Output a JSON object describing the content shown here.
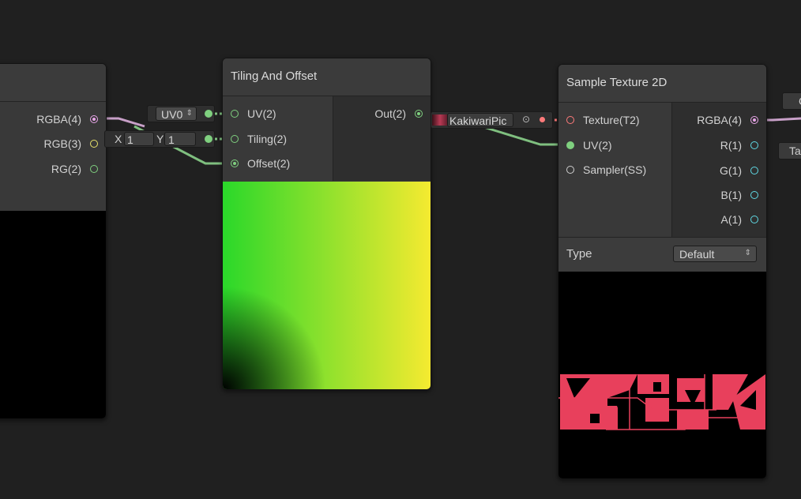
{
  "left_node": {
    "outputs": [
      {
        "label": "RGBA(4)",
        "color": "#e8a6e8"
      },
      {
        "label": "RGB(3)",
        "color": "#e9e36a"
      },
      {
        "label": "RG(2)",
        "color": "#7fd07f"
      }
    ]
  },
  "tiling_node": {
    "title": "Tiling And Offset",
    "inputs": [
      {
        "label": "UV(2)"
      },
      {
        "label": "Tiling(2)"
      },
      {
        "label": "Offset(2)"
      }
    ],
    "output": {
      "label": "Out(2)"
    },
    "uv_control": {
      "value": "UV0",
      "arrow": "⇕"
    },
    "tiling_control": {
      "x_label": "X",
      "x_value": "1",
      "y_label": "Y",
      "y_value": "1"
    }
  },
  "texture_property": {
    "name": "KakiwariPic",
    "icon": "gear-icon"
  },
  "sample_node": {
    "title": "Sample Texture 2D",
    "inputs": [
      {
        "label": "Texture(T2)",
        "color": "#ff7a7a"
      },
      {
        "label": "UV(2)",
        "color": "#7fd07f"
      },
      {
        "label": "Sampler(SS)",
        "color": "#cfcfcf"
      }
    ],
    "outputs": [
      {
        "label": "RGBA(4)",
        "color": "#e8a6e8"
      },
      {
        "label": "R(1)",
        "color": "#5fd9e4"
      },
      {
        "label": "G(1)",
        "color": "#5fd9e4"
      },
      {
        "label": "B(1)",
        "color": "#5fd9e4"
      },
      {
        "label": "A(1)",
        "color": "#5fd9e4"
      }
    ],
    "type_label": "Type",
    "type_value": "Default",
    "type_arrow": "⇕"
  },
  "right_edge": {
    "top_text": "C",
    "bottom_text": "Ta"
  },
  "colors": {
    "background": "#202020",
    "node_body": "#393939",
    "wire_green": "#7fbf7f",
    "wire_pink": "#c8a0c8",
    "texture_pink": "#e8405c"
  }
}
